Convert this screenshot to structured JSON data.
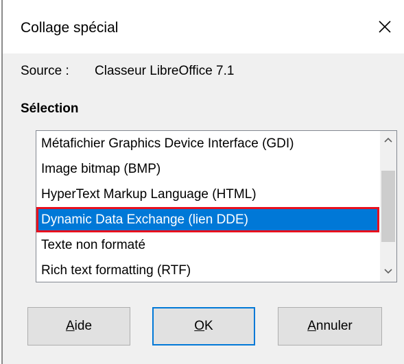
{
  "dialog": {
    "title": "Collage spécial"
  },
  "source": {
    "label": "Source :",
    "value": "Classeur LibreOffice 7.1"
  },
  "selection": {
    "heading": "Sélection",
    "items": [
      {
        "label": "Métafichier Graphics Device Interface (GDI)",
        "selected": false
      },
      {
        "label": "Image bitmap (BMP)",
        "selected": false
      },
      {
        "label": "HyperText Markup Language (HTML)",
        "selected": false
      },
      {
        "label": "Dynamic Data Exchange (lien DDE)",
        "selected": true
      },
      {
        "label": "Texte non formaté",
        "selected": false
      },
      {
        "label": "Rich text formatting (RTF)",
        "selected": false
      }
    ],
    "selected_index": 3
  },
  "buttons": {
    "help": {
      "mnemonic": "A",
      "rest": "ide"
    },
    "ok": {
      "mnemonic": "O",
      "rest": "K"
    },
    "cancel": {
      "mnemonic": "A",
      "rest": "nnuler"
    }
  },
  "colors": {
    "selection_bg": "#0078d7",
    "highlight_outline": "#e8101e",
    "default_button_border": "#0078d7"
  },
  "icons": {
    "close": "close-icon",
    "scroll_up": "chevron-up-icon",
    "scroll_down": "chevron-down-icon"
  }
}
